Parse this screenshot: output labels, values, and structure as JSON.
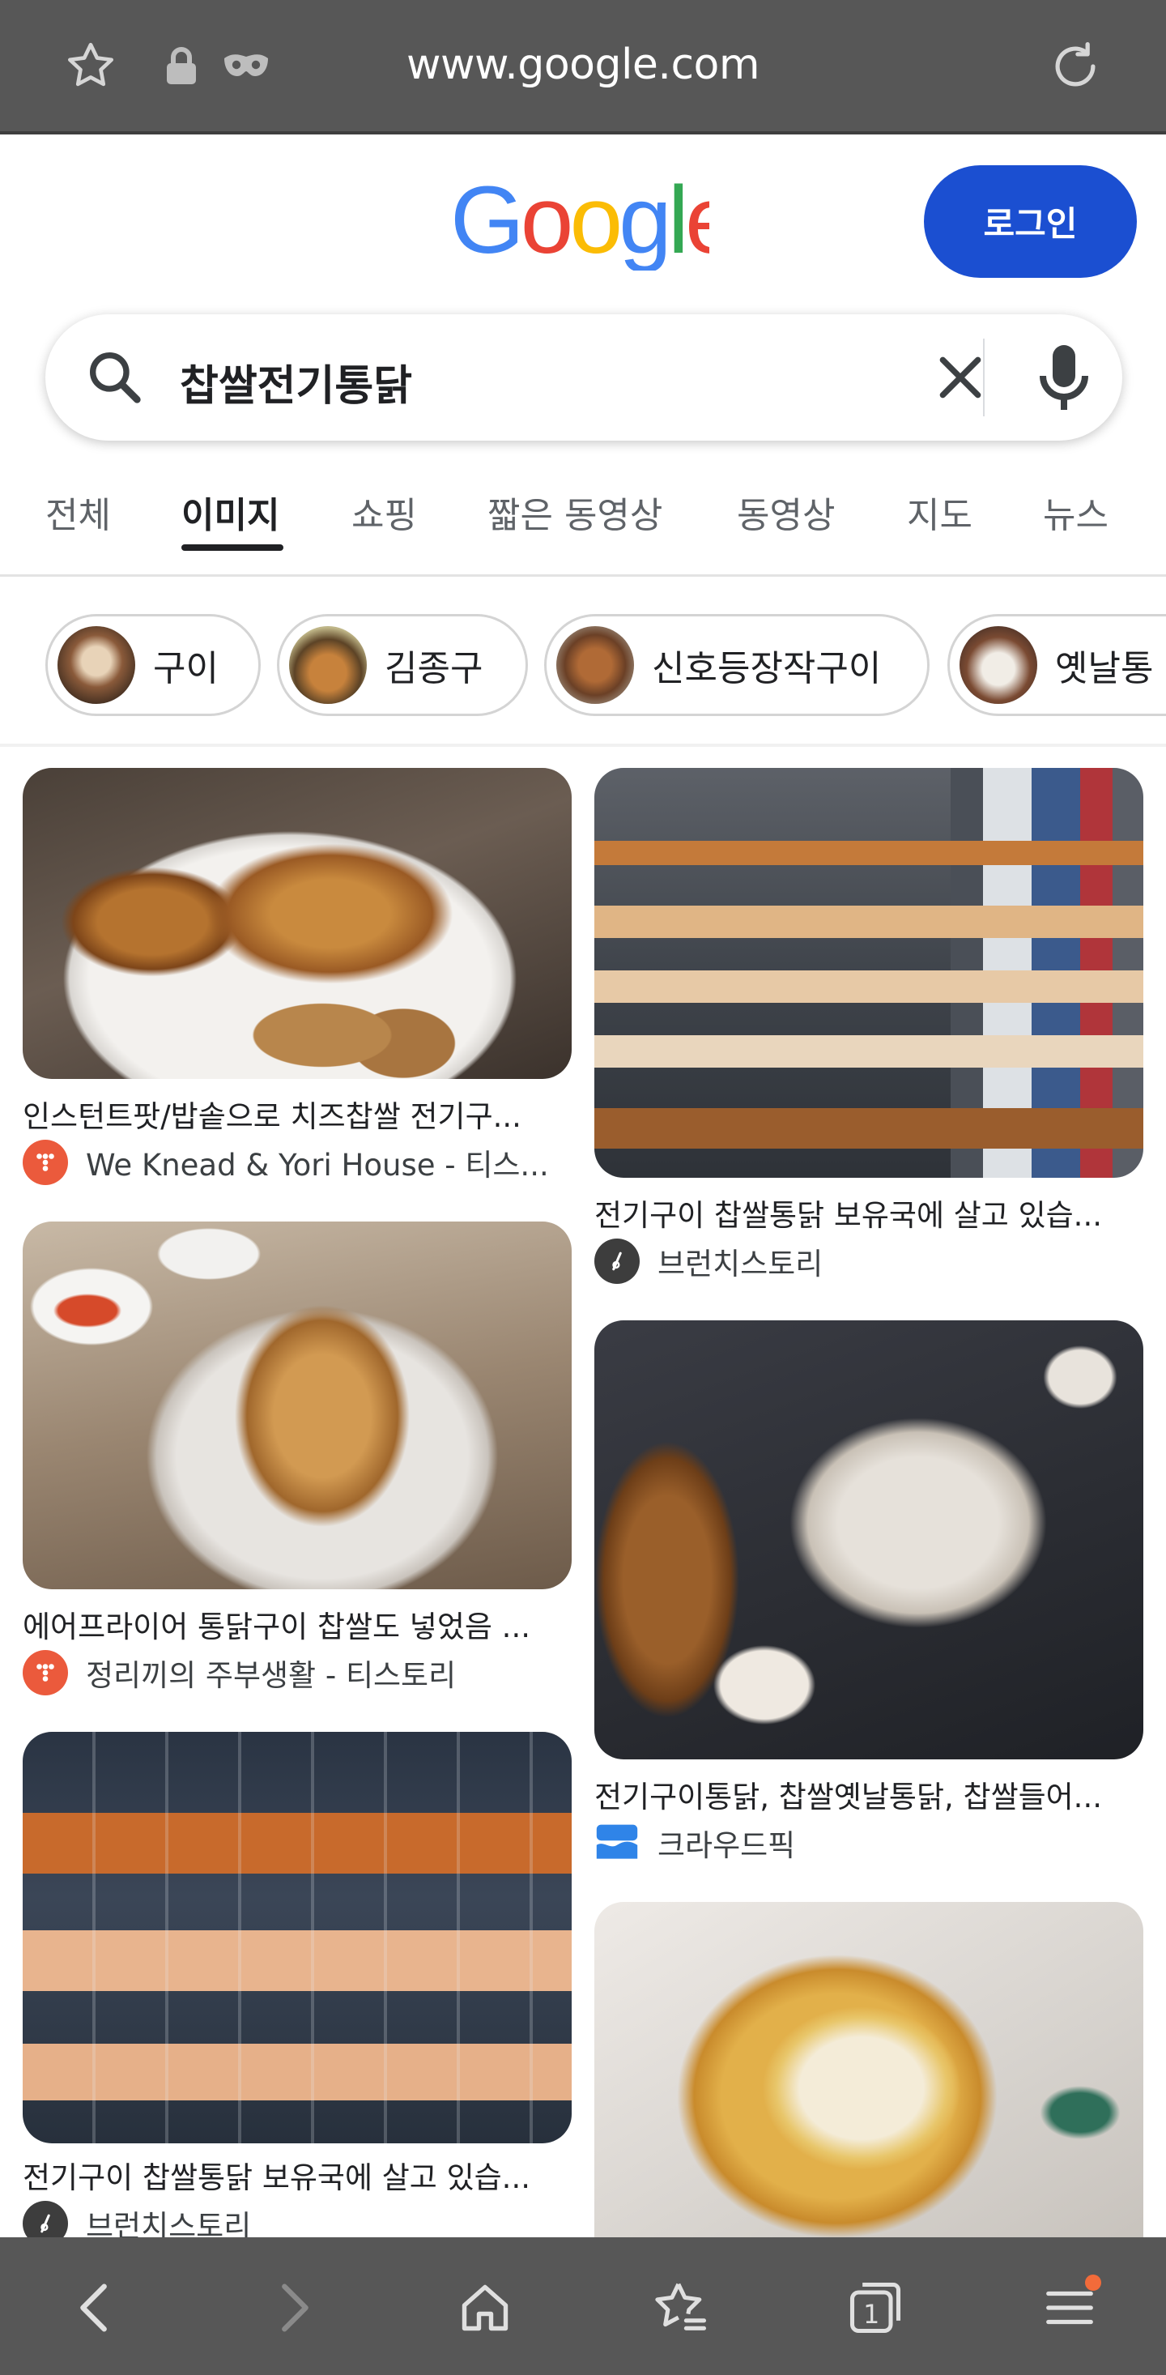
{
  "browser": {
    "url": "www.google.com",
    "icons": [
      "star-outline-icon",
      "lock-icon",
      "incognito-mask-icon",
      "reload-icon"
    ]
  },
  "header": {
    "logo_text": "Google",
    "login_label": "로그인"
  },
  "search": {
    "query": "찹쌀전기통닭",
    "icons": [
      "search-icon",
      "clear-icon",
      "microphone-icon"
    ]
  },
  "tabs": [
    {
      "label": "전체",
      "active": false
    },
    {
      "label": "이미지",
      "active": true
    },
    {
      "label": "쇼핑",
      "active": false
    },
    {
      "label": "짧은 동영상",
      "active": false
    },
    {
      "label": "동영상",
      "active": false
    },
    {
      "label": "지도",
      "active": false
    },
    {
      "label": "뉴스",
      "active": false
    }
  ],
  "chips": [
    {
      "label": "구이"
    },
    {
      "label": "김종구"
    },
    {
      "label": "신호등장작구이"
    },
    {
      "label": "옛날통"
    }
  ],
  "results": {
    "left": [
      {
        "title": "인스턴트팟/밥솥으로 치즈찹쌀 전기구...",
        "source": "We Knead & Yori House - 티스..."
      },
      {
        "title": "에어프라이어 통닭구이 찹쌀도 넣었음 ...",
        "source": "정리끼의 주부생활 - 티스토리"
      },
      {
        "title": "전기구이 찹쌀통닭 보유국에 살고 있습...",
        "source": "브런치스토리"
      }
    ],
    "right": [
      {
        "title": "전기구이 찹쌀통닭 보유국에 살고 있습...",
        "source": "브런치스토리"
      },
      {
        "title": "전기구이통닭, 찹쌀옛날통닭, 찹쌀들어...",
        "source": "크라우드픽"
      },
      {
        "title": "",
        "source": ""
      }
    ]
  },
  "bottom_nav": {
    "icons": [
      "back-icon",
      "forward-icon",
      "home-icon",
      "bookmarks-icon",
      "tabs-icon",
      "menu-icon"
    ],
    "tab_count": "1"
  },
  "colors": {
    "browser_bar": "#575757",
    "login_button": "#1b4fd1",
    "tistory_favicon": "#eb5a3c",
    "brunch_favicon": "#3d3d3d",
    "crowdpic_favicon": "#2f84e8",
    "notification_dot": "#f26b3a"
  }
}
